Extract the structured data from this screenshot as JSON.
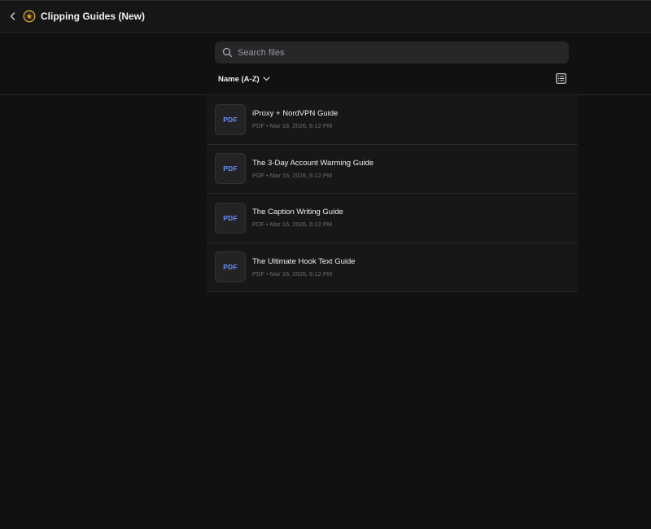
{
  "header": {
    "title": "Clipping Guides (New)",
    "back_icon": "chevron-left-icon",
    "logo_icon": "star-badge-icon"
  },
  "search": {
    "placeholder": "Search files",
    "value": ""
  },
  "toolbar": {
    "sort_label": "Name (A-Z)",
    "view_icon": "list-view-icon"
  },
  "files": [
    {
      "name": "iProxy + NordVPN Guide",
      "thumb_label": "PDF",
      "meta": "PDF • Mar 16, 2026, 6:12 PM"
    },
    {
      "name": "The 3-Day Account Warming Guide",
      "thumb_label": "PDF",
      "meta": "PDF • Mar 16, 2026, 6:12 PM"
    },
    {
      "name": "The Caption Writing Guide",
      "thumb_label": "PDF",
      "meta": "PDF • Mar 16, 2026, 6:12 PM"
    },
    {
      "name": "The Ultimate Hook Text Guide",
      "thumb_label": "PDF",
      "meta": "PDF • Mar 16, 2026, 6:12 PM"
    }
  ],
  "colors": {
    "background": "#111112",
    "row_background": "#171718",
    "pdf_accent": "#6c8ff0",
    "logo_accent": "#d4a53a"
  }
}
